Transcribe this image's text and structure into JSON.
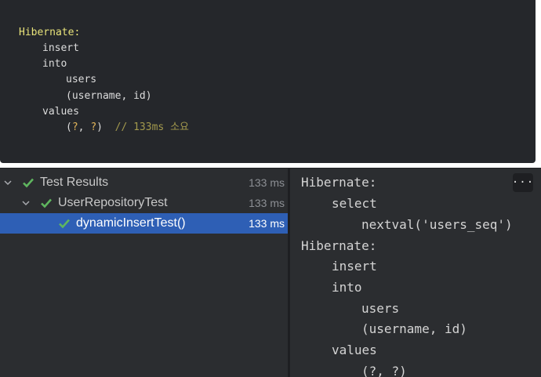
{
  "code_block": {
    "lines": [
      {
        "text": "Hibernate:",
        "indent": 0
      },
      {
        "text": "insert",
        "indent": 1
      },
      {
        "text": "into",
        "indent": 1
      },
      {
        "text": "users",
        "indent": 2
      },
      {
        "text": "(username, id)",
        "indent": 2
      },
      {
        "text": "values",
        "indent": 1
      }
    ],
    "values_line": {
      "open": "(",
      "q1": "?",
      "sep": ", ",
      "q2": "?",
      "close": ")",
      "comment": "// 133ms 소요"
    }
  },
  "test_tree": {
    "rows": [
      {
        "label": "Test Results",
        "time": "133 ms",
        "level": 0,
        "expanded": true,
        "status": "passed",
        "selected": false
      },
      {
        "label": "UserRepositoryTest",
        "time": "133 ms",
        "level": 1,
        "expanded": true,
        "status": "passed",
        "selected": false
      },
      {
        "label": "dynamicInsertTest()",
        "time": "133 ms",
        "level": 2,
        "expanded": false,
        "status": "passed",
        "selected": true
      }
    ]
  },
  "console": {
    "lines": [
      {
        "text": "Hibernate:",
        "indent": 0
      },
      {
        "text": "select",
        "indent": 1
      },
      {
        "text": "nextval('users_seq')",
        "indent": 2
      },
      {
        "text": "Hibernate:",
        "indent": 0
      },
      {
        "text": "insert",
        "indent": 1
      },
      {
        "text": "into",
        "indent": 1
      },
      {
        "text": "users",
        "indent": 2
      },
      {
        "text": "(username, id)",
        "indent": 2
      },
      {
        "text": "values",
        "indent": 1
      },
      {
        "text": "(?, ?)",
        "indent": 2
      }
    ],
    "more_button": "···"
  },
  "colors": {
    "selection": "#2e5fb5",
    "check_green": "#5fb65f",
    "code_keyword": "#e8e37a",
    "comment": "#a3994d"
  }
}
